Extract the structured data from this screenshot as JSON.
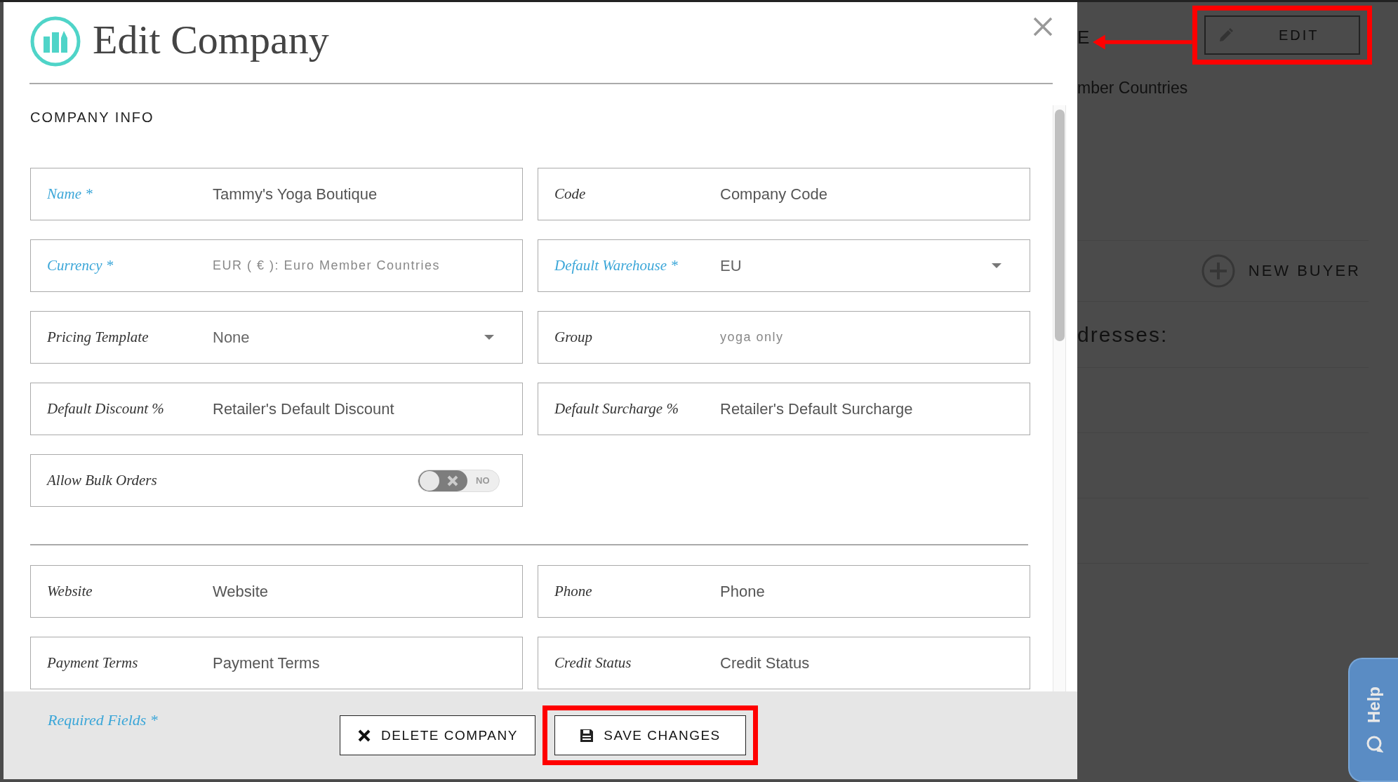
{
  "background": {
    "heading_fragment": "E",
    "edit_button": {
      "label": "EDIT",
      "highlighted": true
    },
    "currency_fragment": "mber Countries",
    "new_buyer_button": {
      "label": "NEW BUYER"
    },
    "addresses_fragment": "dresses:"
  },
  "modal": {
    "title": "Edit Company",
    "sections": [
      {
        "title": "COMPANY INFO",
        "fields": [
          {
            "kind": "input",
            "label": "Name *",
            "required": true,
            "value": "Tammy's Yoga Boutique"
          },
          {
            "kind": "input",
            "label": "Code",
            "required": false,
            "placeholder": "Company Code"
          },
          {
            "kind": "readonly",
            "label": "Currency *",
            "required": true,
            "value": "EUR ( € ): Euro Member Countries"
          },
          {
            "kind": "dropdown",
            "label": "Default Warehouse *",
            "required": true,
            "value": "EU"
          },
          {
            "kind": "dropdown",
            "label": "Pricing Template",
            "required": false,
            "value": "None"
          },
          {
            "kind": "readonly",
            "label": "Group",
            "required": false,
            "value": "yoga only"
          },
          {
            "kind": "input",
            "label": "Default Discount %",
            "required": false,
            "placeholder": "Retailer's Default Discount"
          },
          {
            "kind": "input",
            "label": "Default Surcharge %",
            "required": false,
            "placeholder": "Retailer's Default Surcharge"
          },
          {
            "kind": "toggle",
            "label": "Allow Bulk Orders",
            "required": false,
            "on": false,
            "state_text": "NO"
          }
        ]
      },
      {
        "fields": [
          {
            "kind": "input",
            "label": "Website",
            "required": false,
            "placeholder": "Website"
          },
          {
            "kind": "input",
            "label": "Phone",
            "required": false,
            "placeholder": "Phone"
          },
          {
            "kind": "input",
            "label": "Payment Terms",
            "required": false,
            "placeholder": "Payment Terms"
          },
          {
            "kind": "input",
            "label": "Credit Status",
            "required": false,
            "placeholder": "Credit Status"
          }
        ]
      }
    ],
    "footer": {
      "required_note": "Required Fields *",
      "buttons": [
        {
          "kind": "delete",
          "label": "DELETE COMPANY",
          "highlighted": false
        },
        {
          "kind": "save",
          "label": "SAVE CHANGES",
          "highlighted": true
        }
      ]
    }
  },
  "help_tab": {
    "label": "Help"
  }
}
